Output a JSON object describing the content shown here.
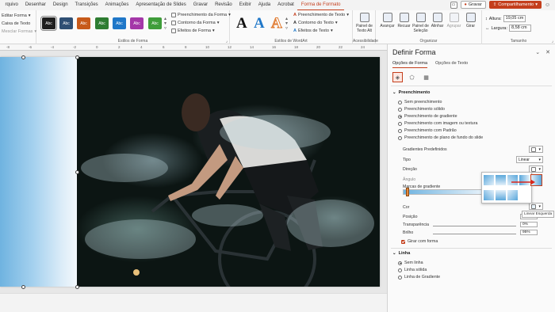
{
  "menubar": {
    "tabs": [
      "rquivo",
      "Desenhar",
      "Design",
      "Transições",
      "Animações",
      "Apresentação de Slides",
      "Gravar",
      "Revisão",
      "Exibir",
      "Ajuda",
      "Acrobat",
      "Forma de Formato"
    ],
    "active_tab": "Forma de Formato",
    "record_label": "Gravar",
    "share_label": "Compartilhamento"
  },
  "ribbon": {
    "insert": {
      "edit_shape": "Editar Forma",
      "text_box": "Caixa de Texto",
      "merge_shapes": "Mesclar Formas"
    },
    "shape_styles": {
      "label": "Estilos de Forma",
      "swatch_text": "Abc",
      "swatches": [
        "#1f1f1f",
        "#2f4f74",
        "#c75a1a",
        "#2e7d32",
        "#1f77c8",
        "#a437a8",
        "#3f9d3a"
      ],
      "fill": "Preenchimento da Forma",
      "outline": "Contorno da Forma",
      "effects": "Efeitos de Forma"
    },
    "wordart": {
      "label": "Estilos de WordArt",
      "text_fill": "Preenchimento de Texto",
      "text_outline": "Contorno do Texto",
      "text_effects": "Efeitos de Texto"
    },
    "accessibility": {
      "label": "Acessibilidade",
      "alt_text": "Painel de Texto Alt"
    },
    "arrange": {
      "label": "Organizar",
      "bring_forward": "Avançar",
      "send_backward": "Recuar",
      "selection_pane": "Painel de Seleção",
      "align": "Alinhar",
      "group": "Agrupar",
      "rotate": "Girar"
    },
    "size": {
      "label": "Tamanho",
      "height_label": "Altura:",
      "height": "19,05 cm",
      "width_label": "Largura:",
      "width": "8,58 cm"
    }
  },
  "ruler": {
    "ticks": [
      "-8",
      "-6",
      "-4",
      "-2",
      "0",
      "2",
      "4",
      "6",
      "8",
      "10",
      "12",
      "14",
      "16",
      "18",
      "20",
      "22",
      "24"
    ]
  },
  "pane": {
    "title": "Definir Forma",
    "tabs": [
      "Opções de Forma",
      "Opções de Texto"
    ],
    "active_tab": "Opções de Forma",
    "fill_section": "Preenchimento",
    "fill_options": [
      {
        "label": "Sem preenchimento",
        "selected": false
      },
      {
        "label": "Preenchimento sólido",
        "selected": false
      },
      {
        "label": "Preenchimento de gradiente",
        "selected": true
      },
      {
        "label": "Preenchimento com imagem ou textura",
        "selected": false
      },
      {
        "label": "Preenchimento com Padrão",
        "selected": false
      },
      {
        "label": "Preenchimento de plano de fundo do slide",
        "selected": false
      }
    ],
    "preset_gradients_label": "Gradientes Predefinidos",
    "type_label": "Tipo",
    "type_value": "Linear",
    "direction_label": "Direção",
    "angle_label": "Ângulo",
    "stops_label": "Marcas de gradiente",
    "color_label": "Cor",
    "position_label": "Posição",
    "position_value": "0%",
    "transparency_label": "Transparência",
    "transparency_value": "0%",
    "brightness_label": "Brilho",
    "brightness_value": "95%",
    "rotate_with_shape": "Girar com forma",
    "line_section": "Linha",
    "line_options": [
      {
        "label": "Sem linha",
        "selected": true
      },
      {
        "label": "Linha sólida",
        "selected": false
      },
      {
        "label": "Linha de Gradiente",
        "selected": false
      }
    ],
    "direction_tooltip": "Linear Esquerda"
  }
}
